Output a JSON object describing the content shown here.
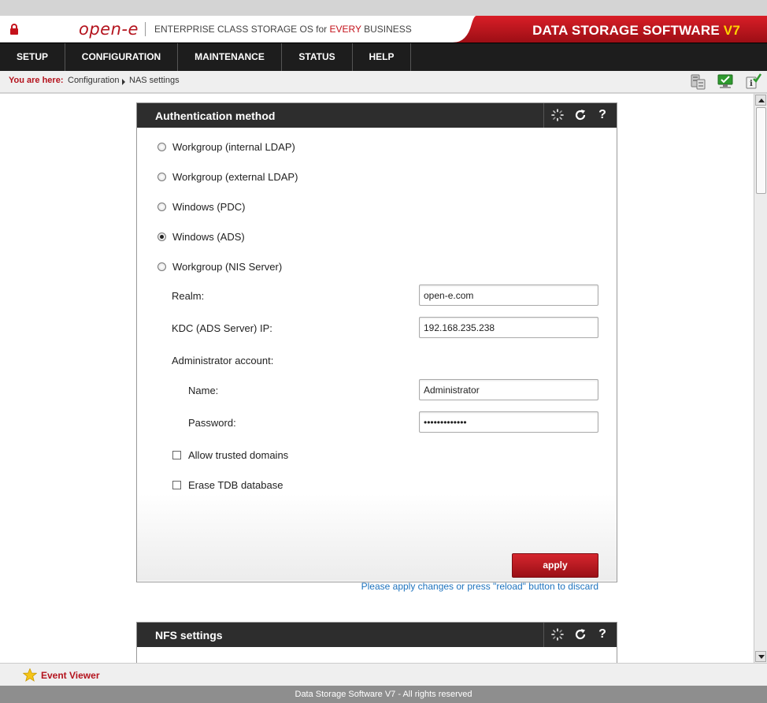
{
  "header": {
    "logo": "open-e",
    "tagline_pre": "ENTERPRISE CLASS STORAGE OS for ",
    "tagline_every": "EVERY",
    "tagline_post": " BUSINESS",
    "brand": "DATA STORAGE SOFTWARE ",
    "brand_version": "V7",
    "accent_color": "#c4121b"
  },
  "nav": {
    "items": [
      {
        "label": "SETUP"
      },
      {
        "label": "CONFIGURATION"
      },
      {
        "label": "MAINTENANCE"
      },
      {
        "label": "STATUS"
      },
      {
        "label": "HELP"
      }
    ]
  },
  "breadcrumb": {
    "prefix": "You are here:",
    "items": [
      "Configuration",
      "NAS settings"
    ]
  },
  "toolbar_icons": [
    "server-status-icon",
    "monitor-check-icon",
    "info-check-icon"
  ],
  "auth_panel": {
    "title": "Authentication method",
    "tools": [
      "spinner-icon",
      "reload-icon",
      "help-icon"
    ],
    "help_label": "?",
    "options": [
      {
        "label": "Workgroup (internal LDAP)",
        "checked": false
      },
      {
        "label": "Workgroup (external LDAP)",
        "checked": false
      },
      {
        "label": "Windows (PDC)",
        "checked": false
      },
      {
        "label": "Windows (ADS)",
        "checked": true
      },
      {
        "label": "Workgroup (NIS Server)",
        "checked": false
      }
    ],
    "realm_label": "Realm:",
    "realm_value": "open-e.com",
    "kdc_label": "KDC (ADS Server) IP:",
    "kdc_value": "192.168.235.238",
    "admin_label": "Administrator account:",
    "name_label": "Name:",
    "name_value": "Administrator",
    "password_label": "Password:",
    "password_value": "•••••••••••••",
    "allow_trusted_label": "Allow trusted domains",
    "erase_tdb_label": "Erase TDB database",
    "apply_label": "apply",
    "apply_note": "Please apply changes or press \"reload\" button to discard"
  },
  "nfs_panel": {
    "title": "NFS settings",
    "help_label": "?"
  },
  "footer": {
    "event_viewer": "Event Viewer",
    "copyright": "Data Storage Software V7 - All rights reserved"
  }
}
